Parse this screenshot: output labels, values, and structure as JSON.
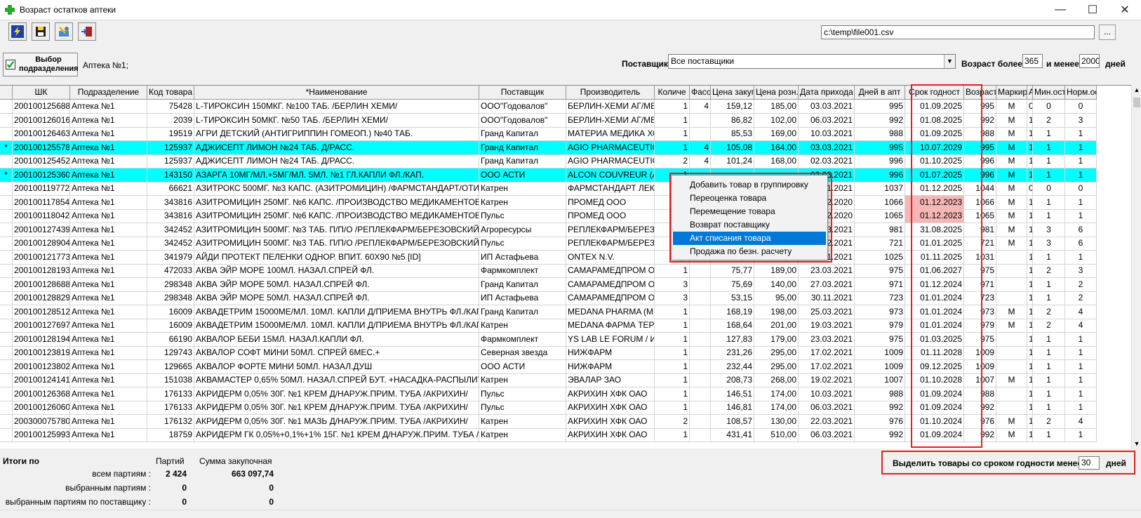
{
  "window": {
    "title": "Возраст остатков аптеки",
    "minimize": "—",
    "maximize": "☐",
    "close": "✕"
  },
  "toolbar": {
    "buttons": [
      "run-icon",
      "save-icon",
      "settings-icon",
      "exit-icon"
    ],
    "path": "c:\\temp\\file001.csv",
    "browse": "..."
  },
  "filters": {
    "select_dept": "Выбор подразделения",
    "dept_value": "Аптека №1;",
    "supplier_label": "Поставщик",
    "supplier_value": "Все поставщики",
    "age_label": "Возраст более",
    "age_min": "365",
    "age_and": "и менее",
    "age_max": "2000",
    "age_days": "дней"
  },
  "columns": [
    "ШК",
    "Подразделение",
    "Код товара",
    "*Наименование",
    "Поставщик",
    "Производитель",
    "Количе",
    "Фасо",
    "Цена закуп",
    "Цена розн.",
    "Дата прихода",
    "Дней в апт",
    "Срок годност",
    "Возраст",
    "Маркир",
    "АМ",
    "Мин.ост.",
    "Норм.ос"
  ],
  "rows": [
    {
      "m": "",
      "c": [
        "200100125688",
        "Аптека №1",
        "75428",
        "L-ТИРОКСИН 150МКГ. №100 ТАБ. /БЕРЛИН ХЕМИ/",
        "ООО\"Годовалов\"",
        "БЕРЛИН-ХЕМИ АГ/МЕНАРИНИ",
        "1",
        "4",
        "159,12",
        "185,00",
        "03.03.2021",
        "995",
        "01.09.2025",
        "995",
        "М",
        "0",
        "0",
        "0"
      ]
    },
    {
      "m": "",
      "c": [
        "200100126016",
        "Аптека №1",
        "2039",
        "L-ТИРОКСИН 50МКГ. №50 ТАБ. /БЕРЛИН ХЕМИ/",
        "ООО\"Годовалов\"",
        "БЕРЛИН-ХЕМИ АГ/МЕНАРИНИ",
        "1",
        "",
        "86,82",
        "102,00",
        "06.03.2021",
        "992",
        "01.08.2025",
        "992",
        "М",
        "1",
        "2",
        "3"
      ]
    },
    {
      "m": "",
      "c": [
        "200100126463",
        "Аптека №1",
        "19519",
        "АГРИ ДЕТСКИЙ (АНТИГРИППИН ГОМЕОП.) №40 ТАБ.",
        "Гранд Капитал",
        "МАТЕРИА МЕДИКА ХОЛДИНГ",
        "1",
        "",
        "85,53",
        "169,00",
        "10.03.2021",
        "988",
        "01.09.2025",
        "988",
        "М",
        "1",
        "1",
        "1"
      ]
    },
    {
      "m": "*",
      "hl": true,
      "c": [
        "200100125578",
        "Аптека №1",
        "125937",
        "АДЖИСЕПТ ЛИМОН №24 ТАБ. Д/РАСС.",
        "Гранд Капитал",
        "AGIO PHARMACEUTICALS",
        "1",
        "4",
        "105,08",
        "164,00",
        "03.03.2021",
        "995",
        "10.07.2029",
        "995",
        "М",
        "1",
        "1",
        "1"
      ]
    },
    {
      "m": "",
      "c": [
        "200100125452",
        "Аптека №1",
        "125937",
        "АДЖИСЕПТ ЛИМОН №24 ТАБ. Д/РАСС.",
        "Гранд Капитал",
        "AGIO PHARMACEUTICALS",
        "2",
        "4",
        "101,24",
        "168,00",
        "02.03.2021",
        "996",
        "01.10.2025",
        "996",
        "М",
        "1",
        "1",
        "1"
      ]
    },
    {
      "m": "*",
      "hl": true,
      "c": [
        "200100125360",
        "Аптека №1",
        "143150",
        "АЗАРГА 10МГ/МЛ.+5МГ/МЛ. 5МЛ. №1 ГЛ.КАПЛИ ФЛ./КАП.",
        "ООО АСТИ",
        "ALCON COUVREUR (АЛКОН)",
        "1",
        "",
        "",
        "",
        "02.03.2021",
        "996",
        "01.07.2025",
        "996",
        "М",
        "1",
        "1",
        "1"
      ]
    },
    {
      "m": "",
      "c": [
        "200100119772",
        "Аптека №1",
        "66621",
        "АЗИТРОКС 500МГ. №3 КАПС. (АЗИТРОМИЦИН) /ФАРМСТАНДАРТ/ОТИСИФАРМ/",
        "Катрен",
        "ФАРМСТАНДАРТ ЛЕКСРЕДСТВА",
        "",
        "",
        "",
        "",
        "13.01.2021",
        "1037",
        "01.12.2025",
        "1044",
        "М",
        "0",
        "0",
        "0"
      ]
    },
    {
      "m": "",
      "c": [
        "200100117854",
        "Аптека №1",
        "343816",
        "АЗИТРОМИЦИН 250МГ. №6 КАПС. /ПРОИЗВОДСТВО МЕДИКАМЕНТОВ/",
        "Катрен",
        "ПРОМЕД ООО",
        "",
        "",
        "",
        "",
        "22.12.2020",
        "1066",
        "01.12.2023",
        "1066",
        "М",
        "1",
        "1",
        "1"
      ],
      "exp": true
    },
    {
      "m": "",
      "c": [
        "200100118042",
        "Аптека №1",
        "343816",
        "АЗИТРОМИЦИН 250МГ. №6 КАПС. /ПРОИЗВОДСТВО МЕДИКАМЕНТОВ/",
        "Пульс",
        "ПРОМЕД ООО",
        "",
        "",
        "",
        "",
        "23.12.2020",
        "1065",
        "01.12.2023",
        "1065",
        "М",
        "1",
        "1",
        "1"
      ],
      "exp": true
    },
    {
      "m": "",
      "c": [
        "200100127439",
        "Аптека №1",
        "342452",
        "АЗИТРОМИЦИН 500МГ. №3 ТАБ. П/П/О /РЕПЛЕКФАРМ/БЕРЕЗОВСКИЙ/",
        "Агроресурсы",
        "РЕПЛЕКФАРМ/БЕРЕЗОВСКИЙ",
        "",
        "",
        "",
        "",
        "17.03.2021",
        "981",
        "31.08.2025",
        "981",
        "М",
        "1",
        "3",
        "6"
      ]
    },
    {
      "m": "",
      "c": [
        "200100128904",
        "Аптека №1",
        "342452",
        "АЗИТРОМИЦИН 500МГ. №3 ТАБ. П/П/О /РЕПЛЕКФАРМ/БЕРЕЗОВСКИЙ/",
        "Пульс",
        "РЕПЛЕКФАРМ/БЕРЕЗОВСКИЙ",
        "",
        "",
        "",
        "",
        "02.12.2021",
        "721",
        "01.01.2025",
        "721",
        "М",
        "1",
        "3",
        "6"
      ]
    },
    {
      "m": "",
      "c": [
        "200100121773",
        "Аптека №1",
        "341979",
        "АЙДИ ПРОТЕКТ ПЕЛЕНКИ ОДНОР. ВПИТ. 60Х90 №5 [ID]",
        "ИП Астафьева",
        "ONTEX N.V.",
        "0,2",
        "5",
        "22,40",
        "140,00",
        "26.01.2021",
        "1025",
        "01.11.2025",
        "1031",
        "",
        "1",
        "1",
        "1"
      ]
    },
    {
      "m": "",
      "c": [
        "200100128193",
        "Аптека №1",
        "472033",
        "АКВА ЭЙР МОРЕ 100МЛ. НАЗАЛ.СПРЕЙ ФЛ.",
        "Фармкомплект",
        "САМАРАМЕДПРОМ ОАО",
        "1",
        "",
        "75,77",
        "189,00",
        "23.03.2021",
        "975",
        "01.06.2027",
        "975",
        "",
        "1",
        "2",
        "3"
      ]
    },
    {
      "m": "",
      "c": [
        "200100128688",
        "Аптека №1",
        "298348",
        "АКВА ЭЙР МОРЕ 50МЛ. НАЗАЛ.СПРЕЙ ФЛ.",
        "Гранд Капитал",
        "САМАРАМЕДПРОМ ОАО",
        "3",
        "",
        "75,69",
        "140,00",
        "27.03.2021",
        "971",
        "01.12.2024",
        "971",
        "",
        "1",
        "1",
        "2"
      ]
    },
    {
      "m": "",
      "c": [
        "200100128829",
        "Аптека №1",
        "298348",
        "АКВА ЭЙР МОРЕ 50МЛ. НАЗАЛ.СПРЕЙ ФЛ.",
        "ИП Астафьева",
        "САМАРАМЕДПРОМ ОАО",
        "3",
        "",
        "53,15",
        "95,00",
        "30.11.2021",
        "723",
        "01.01.2024",
        "723",
        "",
        "1",
        "1",
        "2"
      ]
    },
    {
      "m": "",
      "c": [
        "200100128512",
        "Аптека №1",
        "16009",
        "АКВАДЕТРИМ 15000МЕ/МЛ. 10МЛ. КАПЛИ Д/ПРИЕМА ВНУТРЬ ФЛ./КАП. (ВИТ. Д3)",
        "Гранд Капитал",
        "MEDANA PHARMA (МЕДАНА)",
        "1",
        "",
        "168,19",
        "198,00",
        "25.03.2021",
        "973",
        "01.01.2024",
        "973",
        "М",
        "1",
        "2",
        "4"
      ]
    },
    {
      "m": "",
      "c": [
        "200100127697",
        "Аптека №1",
        "16009",
        "АКВАДЕТРИМ 15000МЕ/МЛ. 10МЛ. КАПЛИ Д/ПРИЕМА ВНУТРЬ ФЛ./КАП. (ВИТ. Д3)",
        "Катрен",
        "MEDANA ФАРМА ТЕРПОЛ",
        "1",
        "",
        "168,64",
        "201,00",
        "19.03.2021",
        "979",
        "01.01.2024",
        "979",
        "М",
        "1",
        "2",
        "4"
      ]
    },
    {
      "m": "",
      "c": [
        "200100128194",
        "Аптека №1",
        "66190",
        "АКВАЛОР БЕБИ 15МЛ. НАЗАЛ.КАПЛИ ФЛ.",
        "Фармкомплект",
        "YS LAB LE FORUM / ИСЛАБ",
        "1",
        "",
        "127,83",
        "179,00",
        "23.03.2021",
        "975",
        "01.03.2025",
        "975",
        "",
        "1",
        "1",
        "1"
      ]
    },
    {
      "m": "",
      "c": [
        "200100123819",
        "Аптека №1",
        "129743",
        "АКВАЛОР СОФТ МИНИ 50МЛ. СПРЕЙ 6МЕС.+",
        "Северная звезда",
        "НИЖФАРМ",
        "1",
        "",
        "231,26",
        "295,00",
        "17.02.2021",
        "1009",
        "01.11.2028",
        "1009",
        "",
        "1",
        "1",
        "1"
      ]
    },
    {
      "m": "",
      "c": [
        "200100123802",
        "Аптека №1",
        "129665",
        "АКВАЛОР ФОРТЕ МИНИ 50МЛ. НАЗАЛ.ДУШ",
        "ООО АСТИ",
        "НИЖФАРМ",
        "1",
        "",
        "232,44",
        "295,00",
        "17.02.2021",
        "1009",
        "09.12.2025",
        "1009",
        "",
        "1",
        "1",
        "1"
      ]
    },
    {
      "m": "",
      "c": [
        "200100124141",
        "Аптека №1",
        "151038",
        "АКВАМАСТЕР 0,65% 50МЛ. НАЗАЛ.СПРЕЙ БУТ. +НАСАДКА-РАСПЫЛИТЕЛЬ",
        "Катрен",
        "ЭВАЛАР ЗАО",
        "1",
        "",
        "208,73",
        "268,00",
        "19.02.2021",
        "1007",
        "01.10.2028",
        "1007",
        "М",
        "1",
        "1",
        "1"
      ]
    },
    {
      "m": "",
      "c": [
        "200100126368",
        "Аптека №1",
        "176133",
        "АКРИДЕРМ 0,05% 30Г. №1 КРЕМ Д/НАРУЖ.ПРИМ. ТУБА /АКРИХИН/",
        "Пульс",
        "АКРИХИН ХФК ОАО",
        "1",
        "",
        "146,51",
        "174,00",
        "10.03.2021",
        "988",
        "01.09.2024",
        "988",
        "",
        "1",
        "1",
        "1"
      ]
    },
    {
      "m": "",
      "c": [
        "200100126060",
        "Аптека №1",
        "176133",
        "АКРИДЕРМ 0,05% 30Г. №1 КРЕМ Д/НАРУЖ.ПРИМ. ТУБА /АКРИХИН/",
        "Пульс",
        "АКРИХИН ХФК ОАО",
        "1",
        "",
        "146,81",
        "174,00",
        "06.03.2021",
        "992",
        "01.09.2024",
        "992",
        "",
        "1",
        "1",
        "1"
      ]
    },
    {
      "m": "",
      "c": [
        "200300075780",
        "Аптека №1",
        "176132",
        "АКРИДЕРМ 0,05% 30Г. №1 МАЗЬ Д/НАРУЖ.ПРИМ. ТУБА /АКРИХИН/",
        "Катрен",
        "АКРИХИН ХФК ОАО",
        "2",
        "",
        "108,57",
        "130,00",
        "22.03.2021",
        "976",
        "01.10.2024",
        "976",
        "М",
        "1",
        "2",
        "4"
      ]
    },
    {
      "m": "",
      "c": [
        "200100125993",
        "Аптека №1",
        "18759",
        "АКРИДЕРМ ГК 0,05%+0,1%+1% 15Г. №1 КРЕМ Д/НАРУЖ.ПРИМ. ТУБА /АКРИХИН/",
        "Катрен",
        "АКРИХИН ХФК ОАО",
        "1",
        "",
        "431,41",
        "510,00",
        "06.03.2021",
        "992",
        "01.09.2024",
        "992",
        "М",
        "1",
        "1",
        "1"
      ]
    }
  ],
  "context_menu": [
    "Добавить товар в группировку",
    "Переоценка товара",
    "Перемещение товара",
    "Возврат поставщику",
    "Акт списания товара",
    "Продажа по безн. расчету"
  ],
  "totals": {
    "title": "Итоги по",
    "col_batches": "Партий",
    "col_sum": "Сумма закупочная",
    "all_label": "всем партиям :",
    "all_batches": "2 424",
    "all_sum": "663 097,74",
    "sel_label": "выбранным партиям :",
    "sel_batches": "0",
    "sel_sum": "0",
    "sup_label": "выбранным партиям по поставщику :",
    "sup_batches": "0",
    "sup_sum": "0"
  },
  "expiry": {
    "label": "Выделить товары со сроком годности менее",
    "value": "30",
    "days": "дней"
  },
  "colors": {
    "highlight": "#00ffff",
    "expired": "#f6b6b6",
    "annotation": "#e32020",
    "menu_selected": "#0078d7"
  }
}
